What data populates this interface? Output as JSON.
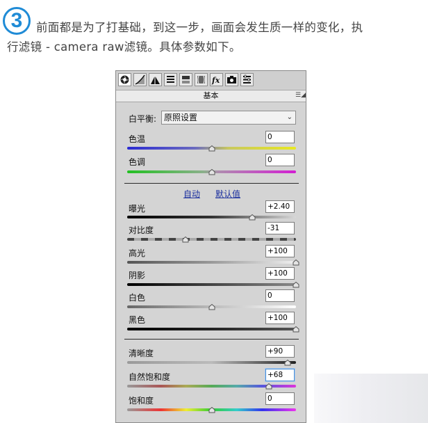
{
  "step_number": "3",
  "caption": {
    "line1": "前面都是为了打基础，到这一步，画面会发生质一样的变化，执",
    "line2": "行滤镜 - camera raw滤镜。具体参数如下。"
  },
  "panel": {
    "toolbar_icons": [
      "basic-icon",
      "tone-curve-icon",
      "detail-icon",
      "hsl-icon",
      "split-toning-icon",
      "lens-correction-icon",
      "fx-icon",
      "camera-calibration-icon",
      "presets-icon"
    ],
    "section_title": "基本",
    "white_balance": {
      "label": "白平衡:",
      "value": "原照设置"
    },
    "auto_link": "自动",
    "default_link": "默认值",
    "sliders": [
      {
        "key": "temperature",
        "label": "色温",
        "value": "0",
        "fraction": 0.5
      },
      {
        "key": "tint",
        "label": "色调",
        "value": "0",
        "fraction": 0.5
      },
      {
        "key": "exposure",
        "label": "曝光",
        "value": "+2.40",
        "fraction": 0.74
      },
      {
        "key": "contrast",
        "label": "对比度",
        "value": "-31",
        "fraction": 0.345
      },
      {
        "key": "highlights",
        "label": "高光",
        "value": "+100",
        "fraction": 1.0
      },
      {
        "key": "shadows",
        "label": "阴影",
        "value": "+100",
        "fraction": 1.0
      },
      {
        "key": "whites",
        "label": "白色",
        "value": "0",
        "fraction": 0.5
      },
      {
        "key": "blacks",
        "label": "黑色",
        "value": "+100",
        "fraction": 1.0
      },
      {
        "key": "clarity",
        "label": "清晰度",
        "value": "+90",
        "fraction": 0.95
      },
      {
        "key": "vibrance",
        "label": "自然饱和度",
        "value": "+68",
        "fraction": 0.84
      },
      {
        "key": "saturation",
        "label": "饱和度",
        "value": "0",
        "fraction": 0.5
      }
    ]
  },
  "colors": {
    "accent": "#1f8bd6",
    "link": "#1b2f9e",
    "panel_bg": "#d4d4d4"
  }
}
